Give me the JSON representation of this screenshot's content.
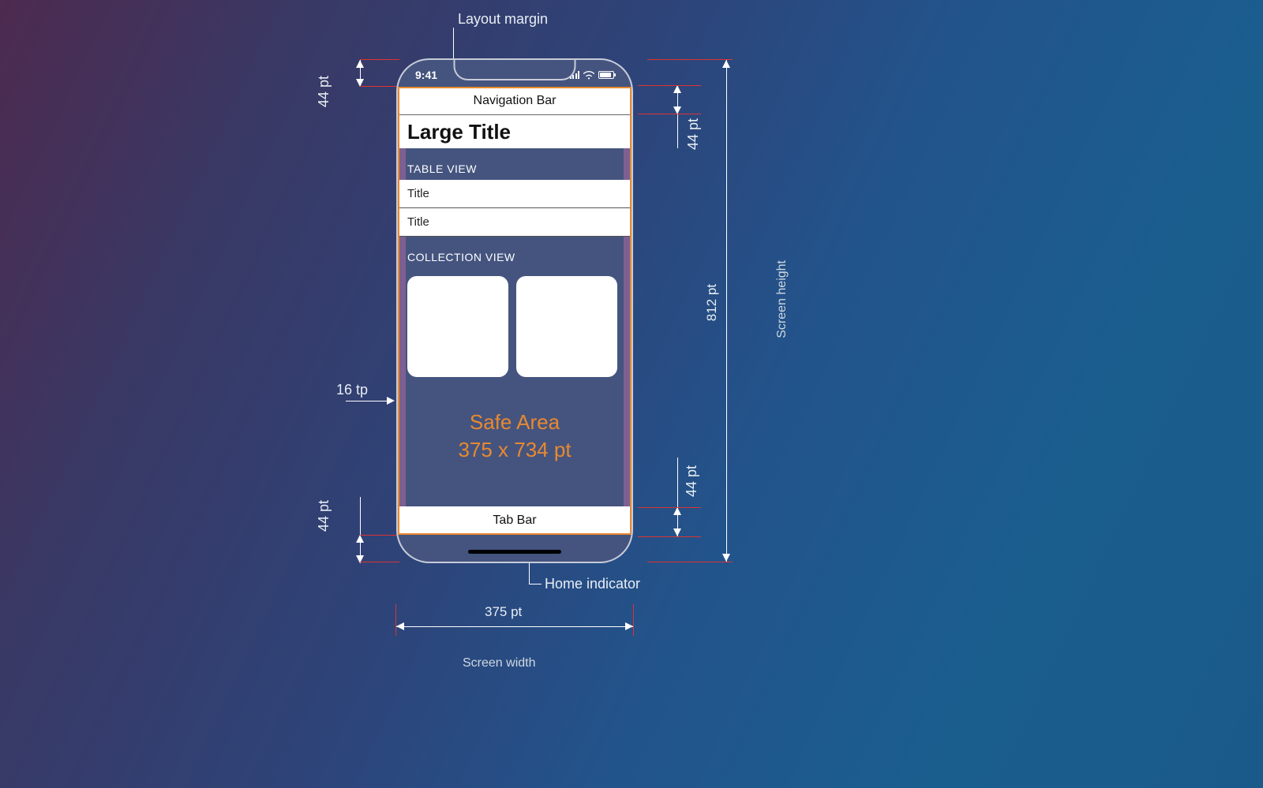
{
  "annotations": {
    "layout_margin": "Layout margin",
    "home_indicator": "Home indicator",
    "screen_width": "Screen width",
    "screen_height": "Screen height"
  },
  "measurements": {
    "status_bar_height": "44 pt",
    "nav_bar_height": "44 pt",
    "tab_bar_height": "44 pt",
    "home_indicator_height": "44 pt",
    "layout_margin_width": "16 tp",
    "screen_height": "812 pt",
    "screen_width": "375 pt"
  },
  "phone": {
    "status_time": "9:41",
    "navigation_bar": "Navigation Bar",
    "large_title": "Large Title",
    "table_view_header": "TABLE VIEW",
    "table_rows": [
      "Title",
      "Title"
    ],
    "collection_view_header": "COLLECTION VIEW",
    "safe_area_line1": "Safe Area",
    "safe_area_line2": "375 x 734 pt",
    "tab_bar": "Tab Bar"
  }
}
